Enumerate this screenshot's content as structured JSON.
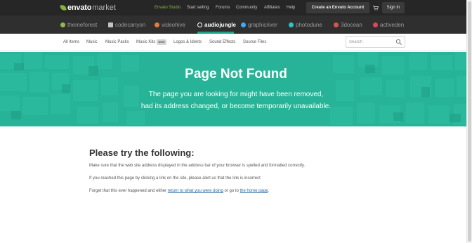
{
  "brand": {
    "envato": "envato",
    "market": "market"
  },
  "topnav": [
    {
      "label": "Envato Studio"
    },
    {
      "label": "Start selling"
    },
    {
      "label": "Forums"
    },
    {
      "label": "Community"
    },
    {
      "label": "Affiliates"
    },
    {
      "label": "Help"
    }
  ],
  "account": {
    "create_label": "Create an Envato Account",
    "signin_label": "Sign In"
  },
  "markets": [
    {
      "label": "themeforest",
      "icon": "themeforest-icon",
      "color": "#8fba4d"
    },
    {
      "label": "codecanyon",
      "icon": "codecanyon-icon",
      "color": "#c2c2c2"
    },
    {
      "label": "videohive",
      "icon": "videohive-icon",
      "color": "#e57b36"
    },
    {
      "label": "audiojungle",
      "icon": "audiojungle-icon",
      "color": "#ffffff"
    },
    {
      "label": "graphicriver",
      "icon": "graphicriver-icon",
      "color": "#3fa9f5"
    },
    {
      "label": "photodune",
      "icon": "photodune-icon",
      "color": "#2ec3c3"
    },
    {
      "label": "3docean",
      "icon": "3docean-icon",
      "color": "#d9534f"
    },
    {
      "label": "activeden",
      "icon": "activeden-icon",
      "color": "#e0455a"
    }
  ],
  "categories": [
    {
      "label": "All Items"
    },
    {
      "label": "Music"
    },
    {
      "label": "Music Packs"
    },
    {
      "label": "Music Kits"
    },
    {
      "label": "Logos & Idents"
    },
    {
      "label": "Sound Effects"
    },
    {
      "label": "Source Files"
    }
  ],
  "new_badge": "NEW",
  "search": {
    "placeholder": "Search"
  },
  "hero": {
    "title": "Page Not Found",
    "line1": "The page you are looking for might have been removed,",
    "line2": "had its address changed, or become temporarily unavailable."
  },
  "content": {
    "title": "Please try the following:",
    "p1": "Make sure that the web site address displayed in the address bar of your browser is spelled and formatted correctly.",
    "p2": "If you reached this page by clicking a link on the site, please alert us that the link is incorrect",
    "p3_pre": "Forget that this ever happened and either",
    "p3_link1": "return to what you were doing",
    "p3_mid": "or go to",
    "p3_link2": "the home page",
    "p3_post": "."
  },
  "colors": {
    "accent": "#26b397",
    "brand_green": "#82b540",
    "link": "#2c6ba7"
  }
}
